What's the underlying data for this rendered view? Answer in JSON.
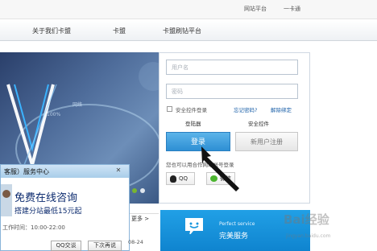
{
  "topbar": {
    "links": [
      "网站平台",
      "一卡通"
    ]
  },
  "nav": {
    "items": [
      "关于我们卡盟",
      "卡盟",
      "卡盟刷钻平台"
    ]
  },
  "banner": {
    "small_text": [
      "网络",
      "100%"
    ]
  },
  "login": {
    "username_placeholder": "用户名",
    "password_placeholder": "密码",
    "remember_label": "安全控件登录",
    "forgot_label": "忘记密码?",
    "unbind_label": "解除绑定",
    "tab_normal": "登陆器",
    "tab_secure": "安全控件",
    "login_button": "登录",
    "register_button": "新用户注册",
    "alt_login_text": "您也可以用合作网站帐号登录",
    "qq_button": "QQ",
    "wechat_button": "微信"
  },
  "service": {
    "title": "客服）服务中心",
    "big_text": "免费在线咨询",
    "sub_text": "搭建分站最低15元起",
    "time_text": "工作时间：10:00-22:00",
    "btn_qq": "QQ交谈",
    "btn_later": "下次再说"
  },
  "news": {
    "more_label": "更多 >",
    "date": "08-24"
  },
  "perfect": {
    "en": "Perfect service",
    "cn": "完美服务"
  },
  "watermark": {
    "text": "Bai经验",
    "url": "jingyan.baidu.com"
  },
  "colors": {
    "login_blue": "#2e8fd4",
    "service_dark": "#0b2a6e",
    "perfect_blue": "#1796dd"
  }
}
